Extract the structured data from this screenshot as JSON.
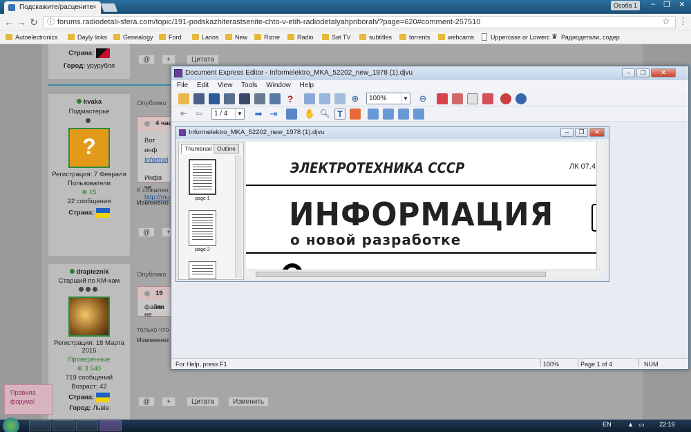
{
  "browser": {
    "tab_title": "Подскажите/расцените",
    "tab_close": "×",
    "profile_label": "Особа 1",
    "url": "forums.radiodetali-sfera.com/topic/191-podskazhiterastsenite-chto-v-etih-radiodetalyahpriborah/?page=620#comment-257510",
    "bookmarks": [
      {
        "label": "Autoelectronics",
        "icon": "folder-icon"
      },
      {
        "label": "Dayly links",
        "icon": "folder-icon"
      },
      {
        "label": "Genealogy",
        "icon": "folder-icon"
      },
      {
        "label": "Ford",
        "icon": "folder-icon"
      },
      {
        "label": "Lanos",
        "icon": "folder-icon"
      },
      {
        "label": "New",
        "icon": "folder-icon"
      },
      {
        "label": "Rizne",
        "icon": "folder-icon"
      },
      {
        "label": "Radio",
        "icon": "folder-icon"
      },
      {
        "label": "Sat TV",
        "icon": "folder-icon"
      },
      {
        "label": "subtitles",
        "icon": "folder-icon"
      },
      {
        "label": "torrents",
        "icon": "folder-icon"
      },
      {
        "label": "webcams",
        "icon": "folder-icon"
      },
      {
        "label": "Uppercase or Lowerc",
        "icon": "page-icon"
      },
      {
        "label": "Радиодетали, содер",
        "icon": "crown-icon"
      }
    ]
  },
  "forum": {
    "user1": {
      "country_label": "Страна:",
      "city_label": "Город:",
      "city": "урурубля"
    },
    "user2": {
      "name": "kvaka",
      "rank": "Подмастерье",
      "avatar_text": "?",
      "reg": "Регистрация: 7 Февраля",
      "group": "Пользователи",
      "rep": "15",
      "posts": "22 сообщения",
      "country_label": "Страна:"
    },
    "post2": {
      "meta": "Опублико",
      "quote_head": "4 час",
      "quote_line1": "Вот инф",
      "quote_link1": "Informel",
      "quote_line2": "Инфа че",
      "quote_link2": "http://mu",
      "line_after": "К сожален",
      "edited": "Изменено"
    },
    "user3": {
      "name": "drapieznik",
      "rank": "Старший по КМ-кам",
      "reg": "Регистрация: 18 Марта 2015",
      "group": "Проверенные",
      "rep": "3 540",
      "posts": "719 сообщений",
      "age": "Возраст: 42",
      "country_label": "Страна:",
      "city_label": "Город:",
      "city": "Львів"
    },
    "post3": {
      "meta": "Опублико",
      "quote_head": "19 ми",
      "quote_line": "файл не",
      "line_after": "только что",
      "edited": "Изменено"
    },
    "buttons": {
      "at": "@",
      "plus": "+",
      "quote": "Цитата",
      "edit": "Изменить"
    },
    "rules": "Правила форума!"
  },
  "dx": {
    "title": "Document Express Editor - Informelektro_MKA_52202_new_1978 (1).djvu",
    "menu": [
      "File",
      "Edit",
      "View",
      "Tools",
      "Window",
      "Help"
    ],
    "zoom": "100%",
    "page_box": "1 / 4",
    "doc_title": "Informelektro_MKA_52202_new_1978 (1).djvu",
    "tabs": {
      "thumbnail": "Thumbnail",
      "outline": "Outline"
    },
    "thumbs": [
      "page 1",
      "page 2"
    ],
    "page_text": {
      "header": "ЭЛЕКТРОТЕХНИКА СССР",
      "code": "ЛК 07.4",
      "big": "ИНФОРМАЦИЯ",
      "sub": "о новой разработке"
    },
    "status": {
      "help": "For Help, press F1",
      "zoom": "100%",
      "page": "Page 1 of 4",
      "num": "NUM"
    }
  },
  "taskbar": {
    "lang": "EN",
    "time": "22:19"
  }
}
